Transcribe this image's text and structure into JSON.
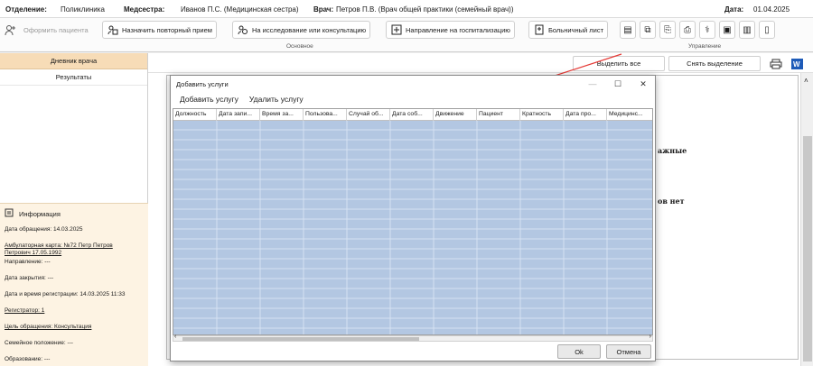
{
  "header": {
    "dept_label": "Отделение:",
    "dept_value": "Поликлиника",
    "nurse_label": "Медсестра:",
    "nurse_value": "Иванов П.С. (Медицинская сестра)",
    "doctor_label": "Врач:",
    "doctor_value": "Петров П.В. (Врач общей практики (семейный врач))",
    "date_label": "Дата:",
    "date_value": "01.04.2025"
  },
  "ribbon": {
    "register_patient": "Оформить пациента",
    "repeat_visit": "Назначить повторный прием",
    "research": "На исследование или консультацию",
    "hospitalization": "Направление на госпитализацию",
    "sick_leave": "Больничный лист",
    "group_main": "Основное",
    "group_manage": "Управление",
    "icons": [
      "person-add-icon",
      "calendar-icon",
      "lab-icon",
      "hospital-icon",
      "sick-leave-icon",
      "record-icon",
      "prescription-icon",
      "document-icon",
      "print-icon",
      "stethoscope-icon",
      "certificate-icon",
      "books-icon",
      "file-icon"
    ]
  },
  "left": {
    "diary": "Дневник врача",
    "results": "Результаты",
    "info_title": "Информация",
    "rows": [
      "Дата обращения: 14.03.2025",
      "Амбулаторная карта: №72 Петр Петров Петрович 17.05.1992",
      "Направление: ---",
      "Дата закрытия: ---",
      "Дата и время регистрации: 14.03.2025 11:33",
      "Регистратор: 1",
      "Цель обращения: Консультация",
      "Семейное положение: ---",
      "Образование: ---"
    ]
  },
  "main": {
    "select_all": "Выделить все",
    "deselect": "Снять выделение",
    "doc_text_1": "ажные",
    "doc_text_2": "ов нет"
  },
  "dialog": {
    "title": "Добавить услуги",
    "menu_add": "Добавить услугу",
    "menu_remove": "Удалить услугу",
    "columns": [
      "Должность",
      "Дата запи...",
      "Время за...",
      "Пользова...",
      "Случай об...",
      "Дата соб...",
      "Движение",
      "Пациент",
      "Кратность",
      "Дата про...",
      "Медицинс..."
    ],
    "ok": "Ok",
    "cancel": "Отмена"
  },
  "colors": {
    "accent": "#f7dcb7",
    "grid": "#b3c7e2",
    "arrow": "#e53935"
  }
}
